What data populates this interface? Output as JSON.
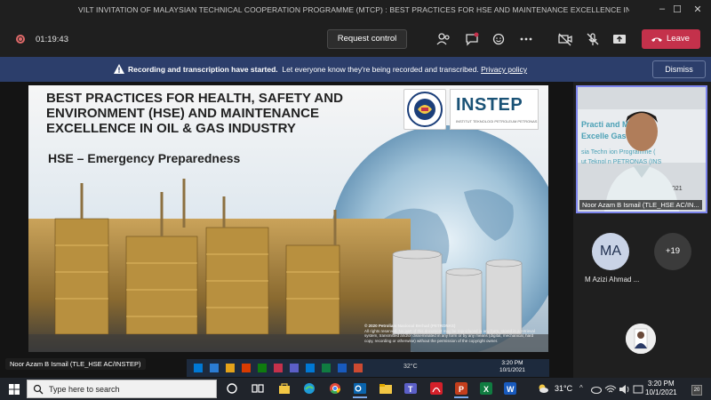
{
  "window": {
    "title": "VILT INVITATION OF MALAYSIAN TECHNICAL COOPERATION PROGRAMME (MTCP) : BEST PRACTICES FOR HSE AND MAINTENANCE EXCELLENCE IN O&G IND...",
    "minimize": "–",
    "maximize": "☐",
    "close": "✕"
  },
  "toolbar": {
    "timer": "01:19:43",
    "request_control_label": "Request control",
    "leave_label": "Leave"
  },
  "banner": {
    "bold_text": "Recording and transcription have started.",
    "text": "Let everyone know they're being recorded and transcribed.",
    "link": "Privacy policy",
    "dismiss_label": "Dismiss"
  },
  "slide": {
    "title": "BEST PRACTICES FOR HEALTH, SAFETY AND ENVIRONMENT (HSE) AND MAINTENANCE EXCELLENCE IN OIL & GAS INDUSTRY",
    "subtitle": "HSE – Emergency Preparedness",
    "instep_logo": "INSTEP",
    "instep_sub": "INSTITUT TEKNOLOGI PETROLEUM PETRONAS",
    "copyright_bold": "© 2020 Petroliam Nasional Berhad (PETRONAS)",
    "copyright_text": "All rights reserved. No part of this document may be reproduced in any form, stored in a retrieval system, transmitted and/or disseminated in any form or by any means (digital, mechanical, hard copy, recording or otherwise) without the permission of the copyright owner."
  },
  "presenter": {
    "name_tag": "Noor Azam B Ismail (TLE_HSE AC/INSTEP)"
  },
  "inner_taskbar": {
    "temp": "32°C",
    "time": "3:20 PM",
    "date": "10/1/2021"
  },
  "participants": {
    "video_name": "Noor Azam B Ismail (TLE_HSE AC/IN...",
    "ma_initials": "MA",
    "ma_name": "M Azizi Ahmad ...",
    "more_count": "+19"
  },
  "taskbar": {
    "search_placeholder": "Type here to search",
    "temperature": "31°C",
    "time": "3:20 PM",
    "date": "10/1/2021",
    "notifications": "20"
  },
  "colors": {
    "banner": "#2c3e6b",
    "leave": "#c4314b",
    "accent": "#7b83eb"
  }
}
